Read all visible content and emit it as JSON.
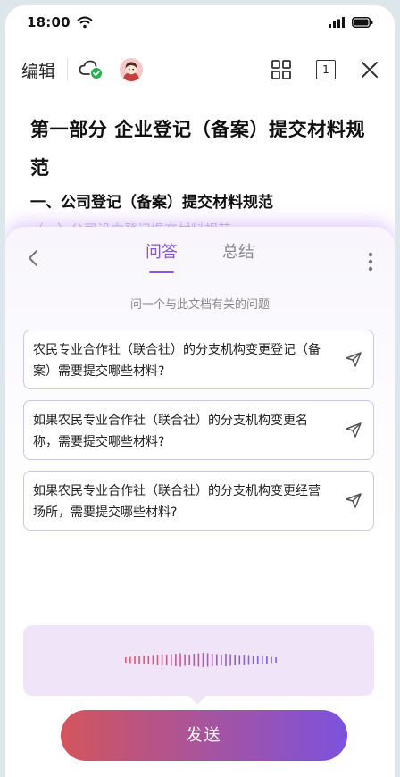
{
  "status_bar": {
    "time": "18:00"
  },
  "topbar": {
    "edit_label": "编辑",
    "page_count": "1"
  },
  "document": {
    "title": "第一部分 企业登记（备案）提交材料规范",
    "subtitle": "一、公司登记（备案）提交材料规范",
    "faded_line": "（一）公司设立登记提交材料规范"
  },
  "sheet": {
    "tabs": [
      {
        "label": "问答",
        "active": true
      },
      {
        "label": "总结",
        "active": false
      }
    ],
    "hint": "问一个与此文档有关的问题",
    "questions": [
      {
        "text": "农民专业合作社（联合社）的分支机构变更登记（备案）需要提交哪些材料?"
      },
      {
        "text": "如果农民专业合作社（联合社）的分支机构变更名称，需要提交哪些材料?"
      },
      {
        "text": "如果农民专业合作社（联合社）的分支机构变更经营场所，需要提交哪些材料?"
      }
    ],
    "send_label": "发送"
  },
  "colors": {
    "accent": "#8a52e0",
    "send_gradient_start": "#d3555d",
    "send_gradient_end": "#7c52dd",
    "voice_panel_bg": "#f0e4f8",
    "sync_ok": "#22b14c"
  }
}
